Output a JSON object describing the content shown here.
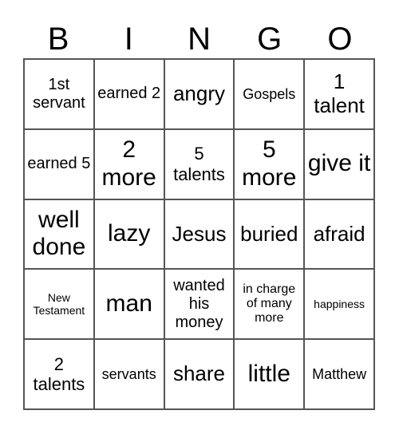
{
  "header": [
    "B",
    "I",
    "N",
    "G",
    "O"
  ],
  "cells": [
    [
      "1st servant",
      "earned 2",
      "angry",
      "Gospels",
      "1 talent"
    ],
    [
      "earned 5",
      "2 more",
      "5 talents",
      "5 more",
      "give it"
    ],
    [
      "well done",
      "lazy",
      "Jesus",
      "buried",
      "afraid"
    ],
    [
      "New Testament",
      "man",
      "wanted his money",
      "in charge of many more",
      "happiness"
    ],
    [
      "2 talents",
      "servants",
      "share",
      "little",
      "Matthew"
    ]
  ]
}
